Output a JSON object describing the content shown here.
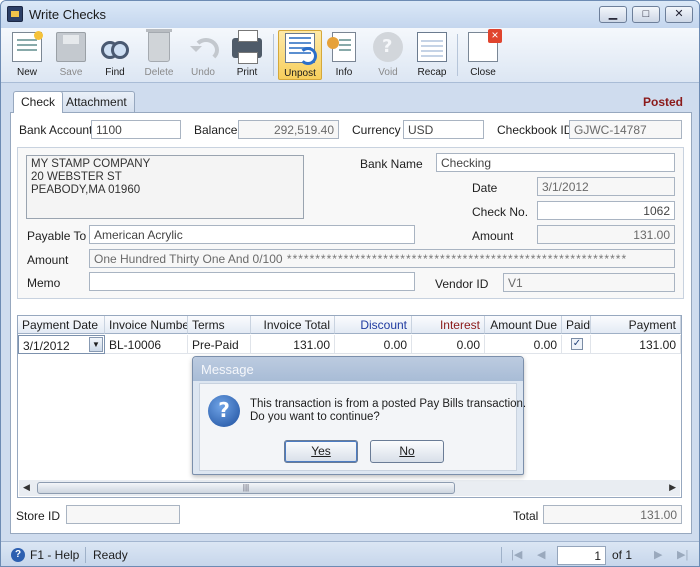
{
  "window": {
    "title": "Write Checks",
    "min": "▁",
    "max": "□",
    "close": "✕"
  },
  "toolbar": {
    "new": "New",
    "save": "Save",
    "find": "Find",
    "delete": "Delete",
    "undo": "Undo",
    "print": "Print",
    "unpost": "Unpost",
    "info": "Info",
    "void": "Void",
    "recap": "Recap",
    "close": "Close"
  },
  "tabs": {
    "check": "Check",
    "attachment": "Attachment"
  },
  "status": "Posted",
  "header": {
    "bank_account_label": "Bank Account",
    "bank_account": "1100",
    "balance_label": "Balance",
    "balance": "292,519.40",
    "currency_label": "Currency",
    "currency": "USD",
    "checkbook_label": "Checkbook ID",
    "checkbook": "GJWC-14787"
  },
  "address": {
    "line1": "MY STAMP COMPANY",
    "line2": "20 WEBSTER ST",
    "line3": "PEABODY,MA 01960"
  },
  "check": {
    "bank_name_label": "Bank Name",
    "bank_name": "Checking",
    "date_label": "Date",
    "date": "3/1/2012",
    "check_no_label": "Check No.",
    "check_no": "1062",
    "amount_label": "Amount",
    "amount": "131.00",
    "payable_to_label": "Payable To",
    "payable_to": "American Acrylic",
    "amount_words_label": "Amount",
    "amount_words": "One Hundred Thirty One And 0/100",
    "memo_label": "Memo",
    "memo": "",
    "vendor_id_label": "Vendor ID",
    "vendor_id": "V1"
  },
  "grid": {
    "columns": [
      "Payment Date",
      "Invoice Number",
      "Terms",
      "Invoice Total",
      "Discount",
      "Interest",
      "Amount Due",
      "Paid",
      "Payment"
    ],
    "rows": [
      {
        "payment_date": "3/1/2012",
        "invoice_number": "BL-10006",
        "terms": "Pre-Paid",
        "invoice_total": "131.00",
        "discount": "0.00",
        "interest": "0.00",
        "amount_due": "0.00",
        "paid": "✓",
        "payment": "131.00"
      }
    ],
    "scroll_grip": "|||"
  },
  "dialog": {
    "title": "Message",
    "line1": "This transaction is from a posted Pay Bills transaction.",
    "line2": "Do you want to continue?",
    "yes": "Yes",
    "no": "No"
  },
  "footer": {
    "store_id_label": "Store ID",
    "store_id": "",
    "total_label": "Total",
    "total": "131.00"
  },
  "statusbar": {
    "help": "F1 - Help",
    "ready": "Ready",
    "page": "1",
    "of": "of 1"
  },
  "colors": {
    "posted": "#8b1a1a",
    "discount_header": "#1f3aa0",
    "interest_header": "#8b1a1a"
  }
}
